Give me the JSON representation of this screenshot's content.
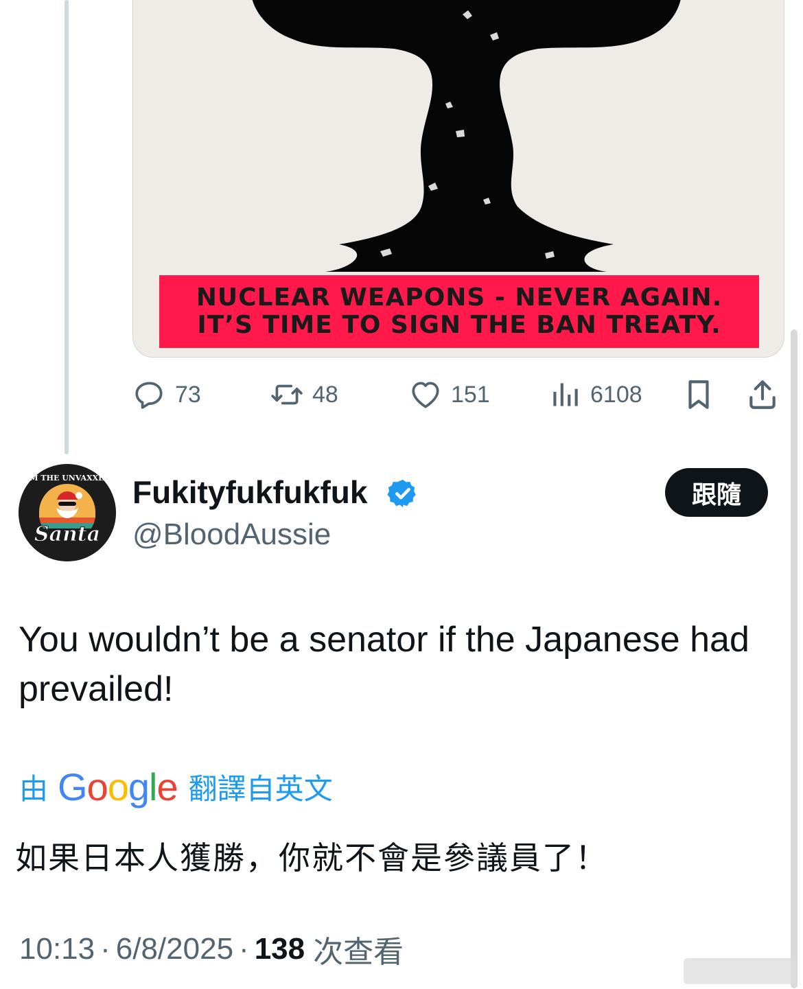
{
  "media": {
    "banner_line1": "NUCLEAR WEAPONS - NEVER AGAIN.",
    "banner_line2": "IT’S TIME TO SIGN THE BAN TREATY.",
    "banner_color": "#ff1a4b"
  },
  "actions": {
    "replies": "73",
    "retweets": "48",
    "likes": "151",
    "views": "6108",
    "icons": [
      "reply-icon",
      "retweet-icon",
      "like-icon",
      "views-icon",
      "bookmark-icon",
      "share-icon"
    ]
  },
  "author": {
    "display_name": "Fukityfukfukfuk",
    "handle": "@BloodAussie",
    "verified": true,
    "avatar_text_top": "I'M THE UNVAXXED",
    "avatar_text_bottom": "Santa",
    "follow_label": "跟隨"
  },
  "tweet": {
    "text": "You wouldn’t be a senator if the Japanese had prevailed!"
  },
  "translation": {
    "prefix": "由",
    "provider": "Google",
    "suffix": "翻譯自英文",
    "text": "如果日本人獲勝，你就不會是參議員了！"
  },
  "meta": {
    "time": "10:13",
    "separator": "·",
    "date": "6/8/2025",
    "view_count": "138",
    "view_label": "次查看"
  },
  "colors": {
    "accent": "#1d9bf0",
    "text_primary": "#0f1419",
    "text_secondary": "#536471"
  }
}
